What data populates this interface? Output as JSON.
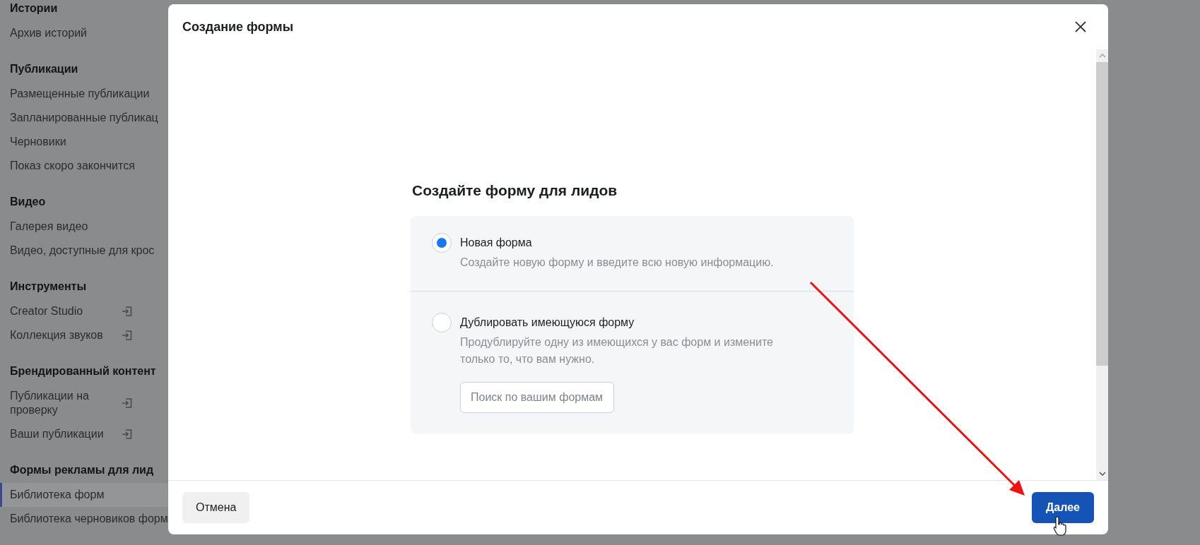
{
  "sidebar": {
    "sections": [
      {
        "title": "Истории",
        "items": [
          {
            "label": "Архив историй",
            "selected": false,
            "external": false
          }
        ]
      },
      {
        "title": "Публикации",
        "items": [
          {
            "label": "Размещенные публикации",
            "selected": false,
            "external": false
          },
          {
            "label": "Запланированные публикац",
            "selected": false,
            "external": false
          },
          {
            "label": "Черновики",
            "selected": false,
            "external": false
          },
          {
            "label": "Показ скоро закончится",
            "selected": false,
            "external": false
          }
        ]
      },
      {
        "title": "Видео",
        "items": [
          {
            "label": "Галерея видео",
            "selected": false,
            "external": false
          },
          {
            "label": "Видео, доступные для крос",
            "selected": false,
            "external": false
          }
        ]
      },
      {
        "title": "Инструменты",
        "items": [
          {
            "label": "Creator Studio",
            "selected": false,
            "external": true
          },
          {
            "label": "Коллекция звуков",
            "selected": false,
            "external": true
          }
        ]
      },
      {
        "title": "Брендированный контент",
        "items": [
          {
            "label": "Публикации на проверку",
            "selected": false,
            "external": true
          },
          {
            "label": "Ваши публикации",
            "selected": false,
            "external": true
          }
        ]
      },
      {
        "title": "Формы рекламы для лид",
        "items": [
          {
            "label": "Библиотека форм",
            "selected": true,
            "external": false
          },
          {
            "label": "Библиотека черновиков форм",
            "selected": false,
            "external": false
          }
        ]
      }
    ]
  },
  "dialog": {
    "title": "Создание формы",
    "heading": "Создайте форму для лидов",
    "options": [
      {
        "title": "Новая форма",
        "description": "Создайте новую форму и введите всю новую информацию.",
        "selected": true
      },
      {
        "title": "Дублировать имеющуюся форму",
        "description": "Продублируйте одну из имеющихся у вас форм и измените только то, что вам нужно.",
        "selected": false,
        "search": {
          "placeholder": "Поиск по вашим формам"
        }
      }
    ],
    "buttons": [
      {
        "label": "Отмена",
        "kind": "secondary"
      },
      {
        "label": "Далее",
        "kind": "primary"
      }
    ]
  }
}
